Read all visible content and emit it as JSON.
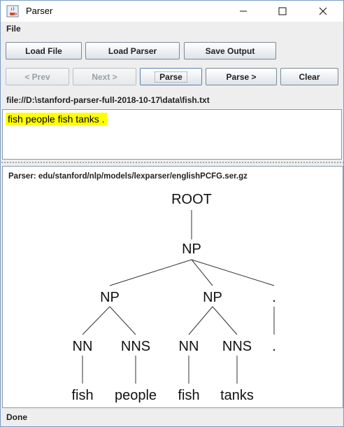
{
  "window": {
    "title": "Parser"
  },
  "menu": {
    "file_label": "File"
  },
  "toolbar": {
    "load_file": "Load File",
    "load_parser": "Load Parser",
    "save_output": "Save Output",
    "prev": "< Prev",
    "next": "Next >",
    "parse": "Parse",
    "parse_next": "Parse >",
    "clear": "Clear"
  },
  "file_path": "file://D:\\stanford-parser-full-2018-10-17\\data\\fish.txt",
  "input": {
    "sentence": "fish people fish tanks ."
  },
  "tree_panel": {
    "parser_label": "Parser: edu/stanford/nlp/models/lexparser/englishPCFG.ser.gz",
    "nodes": {
      "root": "ROOT",
      "np_top": "NP",
      "np_left": "NP",
      "np_mid": "NP",
      "period_tag": ".",
      "nn_1": "NN",
      "nns_1": "NNS",
      "nn_2": "NN",
      "nns_2": "NNS",
      "period_word": ".",
      "word_fish_1": "fish",
      "word_people": "people",
      "word_fish_2": "fish",
      "word_tanks": "tanks"
    }
  },
  "status": {
    "text": "Done"
  }
}
